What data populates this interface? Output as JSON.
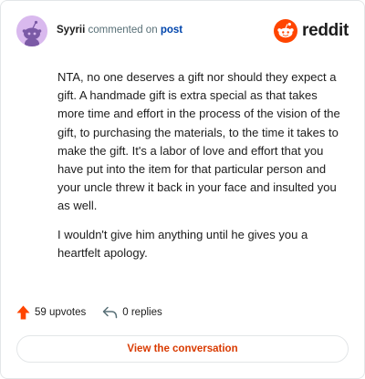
{
  "header": {
    "username": "Syyrii",
    "action_text": "commented on",
    "post_link": "post",
    "logo_text": "reddit",
    "avatar_icon": "snoo-avatar-icon",
    "logo_icon": "reddit-alien-icon"
  },
  "comment": {
    "paragraphs": [
      "NTA, no one deserves a gift nor should they expect a gift. A handmade gift is extra special as that takes more time and effort in the process of the vision of the gift, to purchasing the materials, to the time it takes to make the gift. It's a labor of love and effort that you have put into the item for that particular person and your uncle threw it back in your face and insulted you as well.",
      "I wouldn't give him anything until he gives you a heartfelt apology."
    ]
  },
  "footer": {
    "upvotes": "59 upvotes",
    "replies": "0 replies",
    "upvote_icon": "upvote-arrow-icon",
    "reply_icon": "reply-arrow-icon"
  },
  "cta": {
    "label": "View the conversation"
  },
  "colors": {
    "brand": "#ff4500",
    "link": "#0045ac",
    "cta_text": "#d93a00",
    "avatar_bg": "#d9b9ee"
  }
}
